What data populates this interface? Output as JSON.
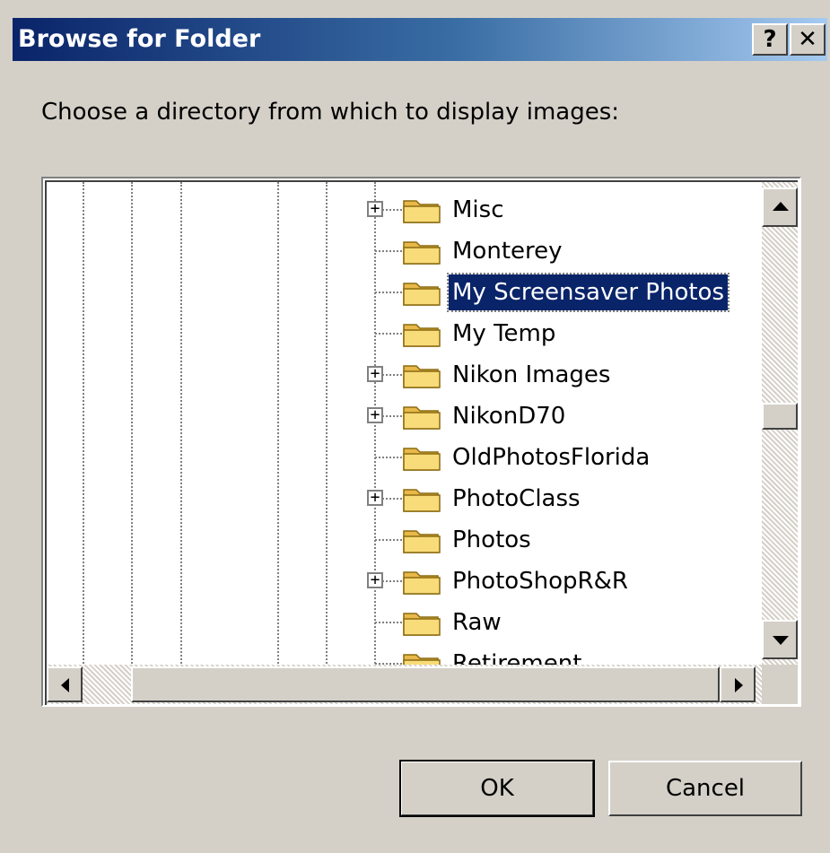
{
  "window": {
    "title": "Browse for Folder",
    "help_label": "?",
    "close_label": "✕"
  },
  "prompt": "Choose a directory from which to display images:",
  "tree": {
    "items": [
      {
        "label": "Misc",
        "expandable": true,
        "selected": false
      },
      {
        "label": "Monterey",
        "expandable": false,
        "selected": false
      },
      {
        "label": "My Screensaver Photos",
        "expandable": false,
        "selected": true
      },
      {
        "label": "My Temp",
        "expandable": false,
        "selected": false
      },
      {
        "label": "Nikon Images",
        "expandable": true,
        "selected": false
      },
      {
        "label": "NikonD70",
        "expandable": true,
        "selected": false
      },
      {
        "label": "OldPhotosFlorida",
        "expandable": false,
        "selected": false
      },
      {
        "label": "PhotoClass",
        "expandable": true,
        "selected": false
      },
      {
        "label": "Photos",
        "expandable": false,
        "selected": false
      },
      {
        "label": "PhotoShopR&R",
        "expandable": true,
        "selected": false
      },
      {
        "label": "Raw",
        "expandable": false,
        "selected": false
      },
      {
        "label": "Retirement",
        "expandable": false,
        "selected": false
      }
    ]
  },
  "buttons": {
    "ok_label": "OK",
    "cancel_label": "Cancel"
  },
  "colors": {
    "title_bar_start": "#0a246a",
    "title_bar_end": "#a6caf0",
    "selection": "#0a246a",
    "face": "#d4d0c8",
    "folder": "#f5d26b"
  }
}
